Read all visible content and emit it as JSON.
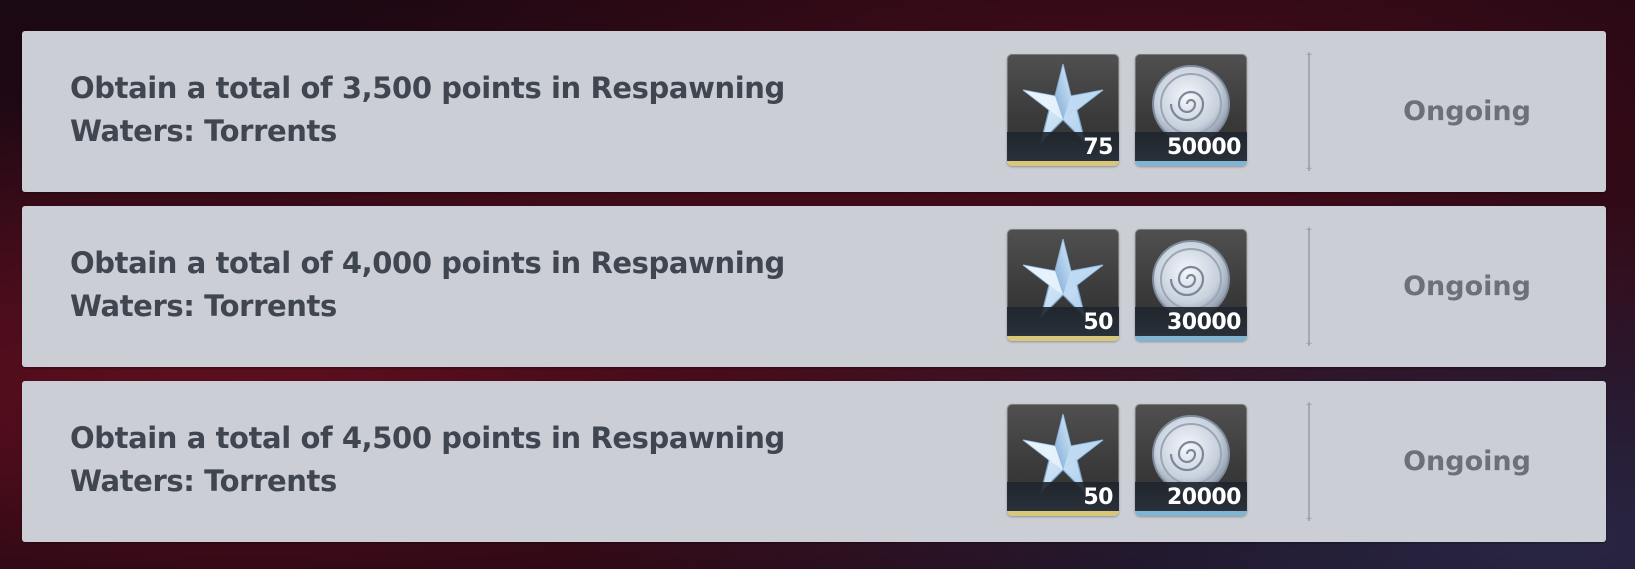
{
  "tasks": [
    {
      "title": "Obtain a total of 3,500 points in Respawning Waters: Torrents",
      "rewards": [
        {
          "icon": "primogem-icon",
          "quantity": "75",
          "rarity_color": "#d8c77a"
        },
        {
          "icon": "mora-coin-icon",
          "quantity": "50000",
          "rarity_color": "#7fb4d2"
        }
      ],
      "status": "Ongoing"
    },
    {
      "title": "Obtain a total of 4,000 points in Respawning Waters: Torrents",
      "rewards": [
        {
          "icon": "primogem-icon",
          "quantity": "50",
          "rarity_color": "#d8c77a"
        },
        {
          "icon": "mora-coin-icon",
          "quantity": "30000",
          "rarity_color": "#7fb4d2"
        }
      ],
      "status": "Ongoing"
    },
    {
      "title": "Obtain a total of 4,500 points in Respawning Waters: Torrents",
      "rewards": [
        {
          "icon": "primogem-icon",
          "quantity": "50",
          "rarity_color": "#d8c77a"
        },
        {
          "icon": "mora-coin-icon",
          "quantity": "20000",
          "rarity_color": "#7fb4d2"
        }
      ],
      "status": "Ongoing"
    }
  ]
}
